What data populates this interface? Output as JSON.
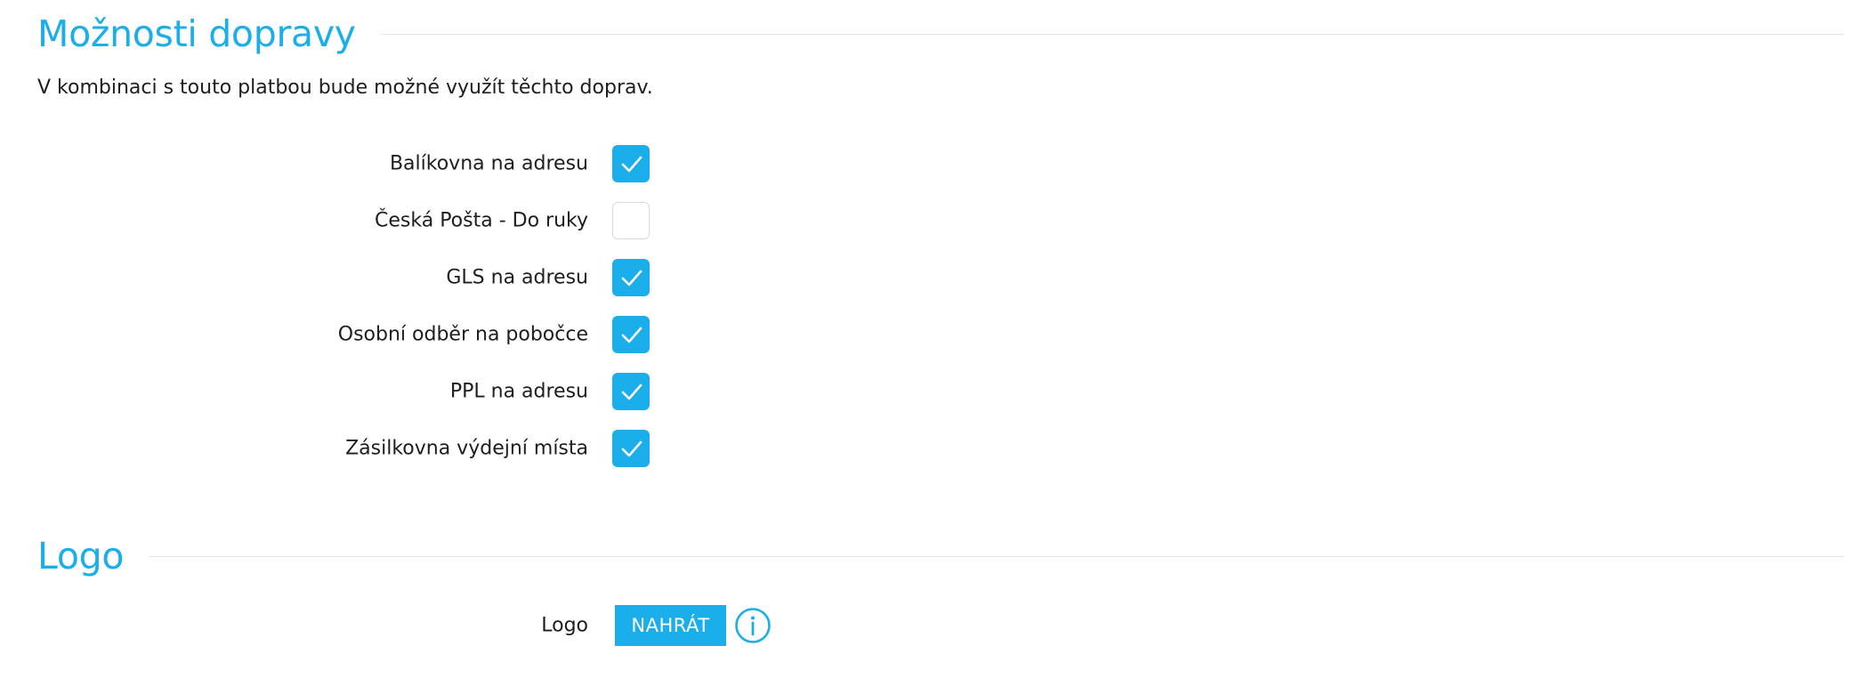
{
  "shipping_section": {
    "title": "Možnosti dopravy",
    "description": "V kombinaci s touto platbou bude možné využít těchto doprav.",
    "options": [
      {
        "label": "Balíkovna na adresu",
        "checked": true
      },
      {
        "label": "Česká Pošta - Do ruky",
        "checked": false
      },
      {
        "label": "GLS na adresu",
        "checked": true
      },
      {
        "label": "Osobní odběr na pobočce",
        "checked": true
      },
      {
        "label": "PPL na adresu",
        "checked": true
      },
      {
        "label": "Zásilkovna výdejní místa",
        "checked": true
      }
    ]
  },
  "logo_section": {
    "title": "Logo",
    "field_label": "Logo",
    "upload_label": "NAHRÁT",
    "info_icon": "info-icon"
  },
  "colors": {
    "accent": "#1aaeea",
    "divider": "#e3e6e9",
    "checkbox_border": "#d6dadf"
  }
}
